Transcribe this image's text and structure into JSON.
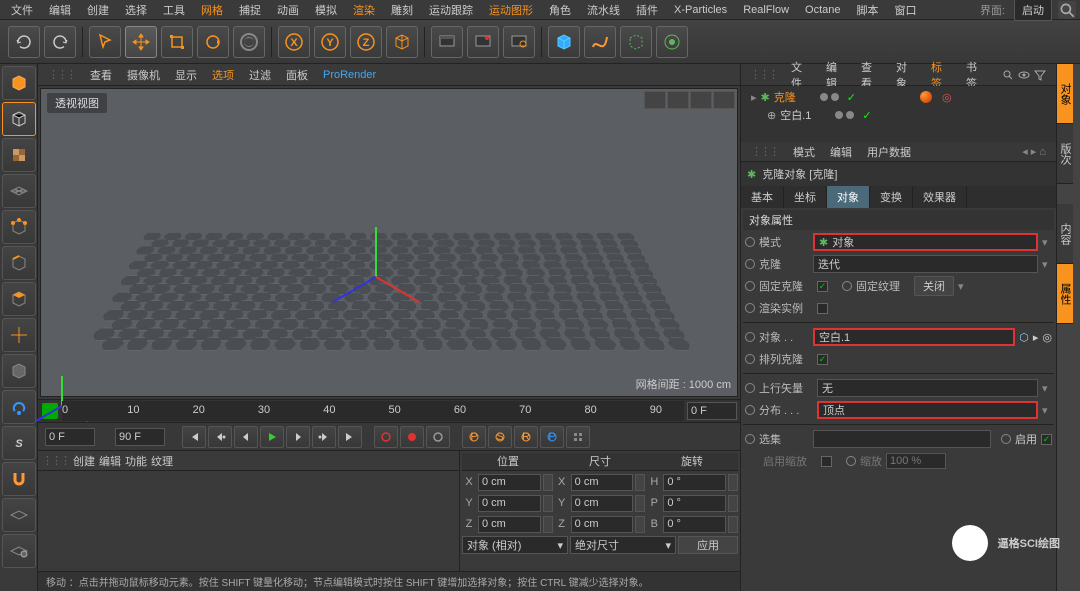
{
  "menu": {
    "items": [
      "文件",
      "编辑",
      "创建",
      "选择",
      "工具",
      "网格",
      "捕捉",
      "动画",
      "模拟",
      "渲染",
      "雕刻",
      "运动跟踪",
      "运动图形",
      "角色",
      "流水线",
      "插件",
      "X-Particles",
      "RealFlow",
      "Octane",
      "脚本",
      "窗口"
    ],
    "hl": [
      5,
      9,
      12
    ],
    "layout_label": "界面:",
    "layout_value": "启动"
  },
  "viewmenu": {
    "items": [
      "查看",
      "摄像机",
      "显示",
      "选项",
      "过滤",
      "面板",
      "ProRender"
    ],
    "hl": [
      3
    ]
  },
  "viewport": {
    "title": "透视视图",
    "grid": "网格间距 : 1000 cm"
  },
  "timeline": {
    "start": "0 F",
    "end": "90 F",
    "current": "0 F",
    "ticks": [
      "0",
      "10",
      "20",
      "30",
      "40",
      "50",
      "60",
      "70",
      "80",
      "90"
    ]
  },
  "materials": {
    "menu": [
      "创建",
      "编辑",
      "功能",
      "纹理"
    ]
  },
  "coords": {
    "hdr": [
      "位置",
      "尺寸",
      "旋转"
    ],
    "rows": [
      {
        "l": "X",
        "p": "0 cm",
        "s": "0 cm",
        "r": "0 °"
      },
      {
        "l": "Y",
        "p": "0 cm",
        "s": "0 cm",
        "r": "0 °"
      },
      {
        "l": "Z",
        "p": "0 cm",
        "s": "0 cm",
        "r": "0 °"
      }
    ],
    "sel1": "对象 (相对)",
    "sel2": "绝对尺寸",
    "apply": "应用",
    "h": "H",
    "p": "P",
    "b": "B"
  },
  "status": "移动 ：点击并拖动鼠标移动元素。按住 SHIFT 键量化移动；节点编辑模式时按住 SHIFT 键增加选择对象；按住 CTRL 键减少选择对象。",
  "objmgr": {
    "menu": [
      "文件",
      "编辑",
      "查看",
      "对象",
      "标签",
      "书签"
    ],
    "on": 4,
    "tree": [
      {
        "name": "克隆",
        "sel": true
      },
      {
        "name": "空白.1",
        "sel": false
      }
    ]
  },
  "attr": {
    "menu": [
      "模式",
      "编辑",
      "用户数据"
    ],
    "title": "克隆对象 [克隆]",
    "tabs": [
      "基本",
      "坐标",
      "对象",
      "变换",
      "效果器"
    ],
    "active": 2,
    "section": "对象属性",
    "mode_l": "模式",
    "mode_v": "对象",
    "clone_l": "克隆",
    "clone_v": "迭代",
    "fix_l": "固定克隆",
    "tex_l": "固定纹理",
    "tex_v": "关闭",
    "inst_l": "渲染实例",
    "obj_l": "对象 . .",
    "obj_v": "空白.1",
    "sort_l": "排列克隆",
    "up_l": "上行矢量",
    "up_v": "无",
    "dist_l": "分布 . . .",
    "dist_v": "顶点",
    "sel_l": "选集",
    "enable_l": "启用",
    "scale_l": "启用缩放",
    "scale2_l": "缩放",
    "scale_v": "100 %"
  },
  "rtabs": [
    "对象",
    "版次",
    "内容",
    "属性"
  ],
  "watermark": "逼格SCI绘图"
}
